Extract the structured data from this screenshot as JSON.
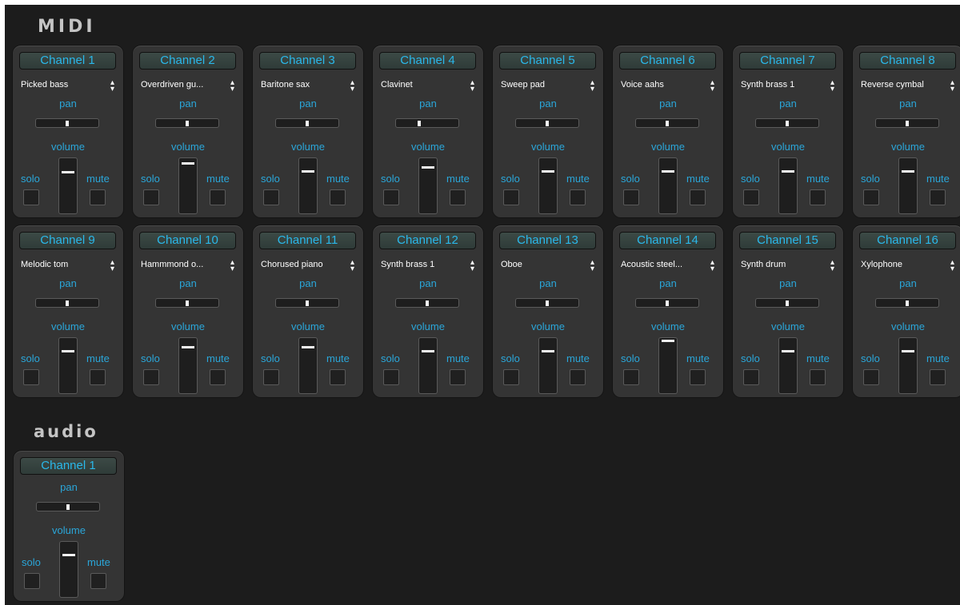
{
  "sections": {
    "midi_title": "MIDI",
    "audio_title": "audio"
  },
  "labels": {
    "pan": "pan",
    "volume": "volume",
    "solo": "solo",
    "mute": "mute"
  },
  "colors": {
    "accent": "#2aa6d9",
    "channel_button_text": "#2ab8ea",
    "strip_background": "#343434",
    "app_background": "#1c1c1c"
  },
  "icons": {
    "instrument_select": "up-down-arrows-icon"
  },
  "midi_channels": [
    {
      "name": "Channel 1",
      "instrument": "Picked bass",
      "pan": 0.5,
      "volume": 0.75
    },
    {
      "name": "Channel 2",
      "instrument": "Overdriven gu...",
      "pan": 0.5,
      "volume": 0.91
    },
    {
      "name": "Channel 3",
      "instrument": "Baritone sax",
      "pan": 0.5,
      "volume": 0.77
    },
    {
      "name": "Channel 4",
      "instrument": "Clavinet",
      "pan": 0.37,
      "volume": 0.84
    },
    {
      "name": "Channel 5",
      "instrument": "Sweep pad",
      "pan": 0.5,
      "volume": 0.77
    },
    {
      "name": "Channel 6",
      "instrument": "Voice aahs",
      "pan": 0.5,
      "volume": 0.77
    },
    {
      "name": "Channel 7",
      "instrument": "Synth brass 1",
      "pan": 0.5,
      "volume": 0.77
    },
    {
      "name": "Channel 8",
      "instrument": "Reverse cymbal",
      "pan": 0.5,
      "volume": 0.77
    },
    {
      "name": "Channel 9",
      "instrument": "Melodic tom",
      "pan": 0.5,
      "volume": 0.77
    },
    {
      "name": "Channel 10",
      "instrument": "Hammmond o...",
      "pan": 0.5,
      "volume": 0.84
    },
    {
      "name": "Channel 11",
      "instrument": "Chorused piano",
      "pan": 0.5,
      "volume": 0.84
    },
    {
      "name": "Channel 12",
      "instrument": "Synth brass 1",
      "pan": 0.5,
      "volume": 0.77
    },
    {
      "name": "Channel 13",
      "instrument": "Oboe",
      "pan": 0.5,
      "volume": 0.77
    },
    {
      "name": "Channel 14",
      "instrument": "Acoustic steel...",
      "pan": 0.5,
      "volume": 0.96
    },
    {
      "name": "Channel 15",
      "instrument": "Synth drum",
      "pan": 0.5,
      "volume": 0.77
    },
    {
      "name": "Channel 16",
      "instrument": "Xylophone",
      "pan": 0.5,
      "volume": 0.77
    }
  ],
  "audio_channels": [
    {
      "name": "Channel 1",
      "pan": 0.5,
      "volume": 0.77
    }
  ]
}
